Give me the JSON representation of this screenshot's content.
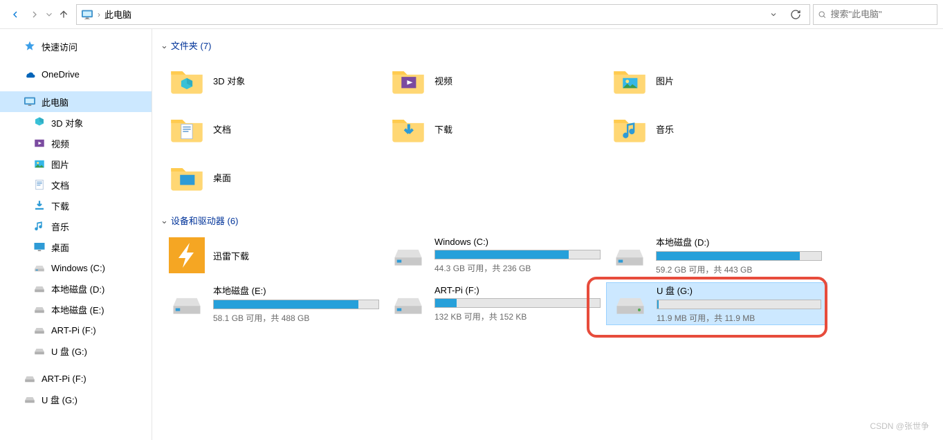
{
  "toolbar": {
    "location_label": "此电脑",
    "search_placeholder": "搜索\"此电脑\""
  },
  "sidebar": {
    "items": [
      {
        "icon": "star",
        "label": "快速访问",
        "indent": false
      },
      {
        "icon": "onedrive",
        "label": "OneDrive",
        "indent": false
      },
      {
        "icon": "thispc",
        "label": "此电脑",
        "indent": false,
        "selected": true
      },
      {
        "icon": "cube",
        "label": "3D 对象",
        "indent": true
      },
      {
        "icon": "video",
        "label": "视频",
        "indent": true
      },
      {
        "icon": "picture",
        "label": "图片",
        "indent": true
      },
      {
        "icon": "doc",
        "label": "文档",
        "indent": true
      },
      {
        "icon": "download",
        "label": "下载",
        "indent": true
      },
      {
        "icon": "music",
        "label": "音乐",
        "indent": true
      },
      {
        "icon": "desktop",
        "label": "桌面",
        "indent": true
      },
      {
        "icon": "disk",
        "label": "Windows (C:)",
        "indent": true
      },
      {
        "icon": "hdd",
        "label": "本地磁盘 (D:)",
        "indent": true
      },
      {
        "icon": "hdd",
        "label": "本地磁盘 (E:)",
        "indent": true
      },
      {
        "icon": "hdd",
        "label": "ART-Pi (F:)",
        "indent": true
      },
      {
        "icon": "hdd",
        "label": "U 盘 (G:)",
        "indent": true
      },
      {
        "icon": "hdd",
        "label": "ART-Pi (F:)",
        "indent": false
      },
      {
        "icon": "hdd",
        "label": "U 盘 (G:)",
        "indent": false
      }
    ]
  },
  "main": {
    "sections": {
      "folders": {
        "title": "文件夹 (7)",
        "items": [
          {
            "icon": "cube",
            "label": "3D 对象"
          },
          {
            "icon": "video",
            "label": "视频"
          },
          {
            "icon": "picture",
            "label": "图片"
          },
          {
            "icon": "doc",
            "label": "文档"
          },
          {
            "icon": "download",
            "label": "下载"
          },
          {
            "icon": "music",
            "label": "音乐"
          },
          {
            "icon": "desktop",
            "label": "桌面"
          }
        ]
      },
      "drives": {
        "title": "设备和驱动器 (6)",
        "items": [
          {
            "icon": "xunlei",
            "name": "迅雷下载",
            "stats": "",
            "fill": 0,
            "nobar": true
          },
          {
            "icon": "disk",
            "name": "Windows (C:)",
            "stats": "44.3 GB 可用，共 236 GB",
            "fill": 81
          },
          {
            "icon": "disk",
            "name": "本地磁盘 (D:)",
            "stats": "59.2 GB 可用，共 443 GB",
            "fill": 87
          },
          {
            "icon": "disk",
            "name": "本地磁盘 (E:)",
            "stats": "58.1 GB 可用，共 488 GB",
            "fill": 88
          },
          {
            "icon": "disk",
            "name": "ART-Pi (F:)",
            "stats": "132 KB 可用，共 152 KB",
            "fill": 13
          },
          {
            "icon": "usb",
            "name": "U 盘 (G:)",
            "stats": "11.9 MB 可用，共 11.9 MB",
            "fill": 1,
            "selected": true,
            "highlighted": true
          }
        ]
      }
    }
  },
  "watermark": "CSDN @张世争"
}
